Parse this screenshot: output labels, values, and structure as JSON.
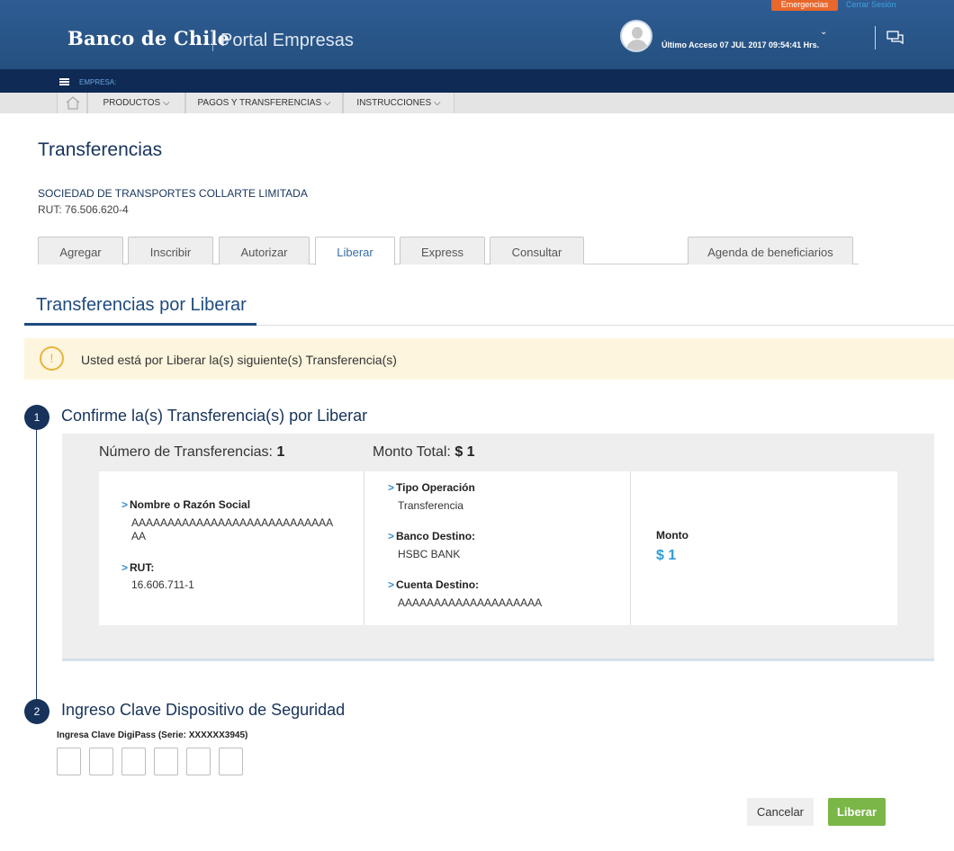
{
  "header": {
    "brand": "Banco de Chile",
    "portal": "Portal Empresas",
    "emergencias": "Emergencias",
    "cerrar_sesion": "Cerrar Sesión",
    "last_access": "Último Acceso 07 JUL 2017 09:54:41 Hrs."
  },
  "empresa_bar": {
    "label": "EMPRESA:"
  },
  "nav": {
    "items": [
      "PRODUCTOS ⌵",
      "PAGOS Y TRANSFERENCIAS ⌵",
      "INSTRUCCIONES ⌵"
    ]
  },
  "page": {
    "title": "Transferencias",
    "company": "SOCIEDAD DE TRANSPORTES COLLARTE LIMITADA",
    "rut": "RUT: 76.506.620-4"
  },
  "tabs": [
    "Agregar",
    "Inscribir",
    "Autorizar",
    "Liberar",
    "Express",
    "Consultar",
    "Agenda de beneficiarios"
  ],
  "active_tab": "Liberar",
  "section": {
    "title": "Transferencias por Liberar"
  },
  "alert": {
    "text": "Usted está por Liberar la(s) siguiente(s) Transferencia(s)"
  },
  "step1": {
    "number": "1",
    "title": "Confirme la(s) Transferencia(s) por Liberar",
    "num_transfer_label": "Número de Transferencias:",
    "num_transfer_value": "1",
    "monto_total_label": "Monto Total:",
    "monto_total_value": "$ 1",
    "nombre_label": "Nombre o Razón Social",
    "nombre_value_line1": "AAAAAAAAAAAAAAAAAAAAAAAAAAAA",
    "nombre_value_line2": "AA",
    "rut_label": "RUT:",
    "rut_value": "16.606.711-1",
    "tipo_label": "Tipo Operación",
    "tipo_value": "Transferencia",
    "banco_label": "Banco Destino:",
    "banco_value": "HSBC BANK",
    "cuenta_label": "Cuenta Destino:",
    "cuenta_value": "AAAAAAAAAAAAAAAAAAAA",
    "monto_label": "Monto",
    "monto_value": "$ 1"
  },
  "step2": {
    "number": "2",
    "title": "Ingreso Clave Dispositivo de Seguridad",
    "digipass_label": "Ingresa Clave DigiPass (Serie: XXXXXX3945)"
  },
  "buttons": {
    "cancel": "Cancelar",
    "submit": "Liberar"
  },
  "colors": {
    "header_blue": "#2f5c93",
    "navy": "#17335c",
    "accent_orange": "#e8672c",
    "success_green": "#7ab648",
    "alert_bg": "#fdf5de",
    "link_blue": "#2f9bd7"
  }
}
